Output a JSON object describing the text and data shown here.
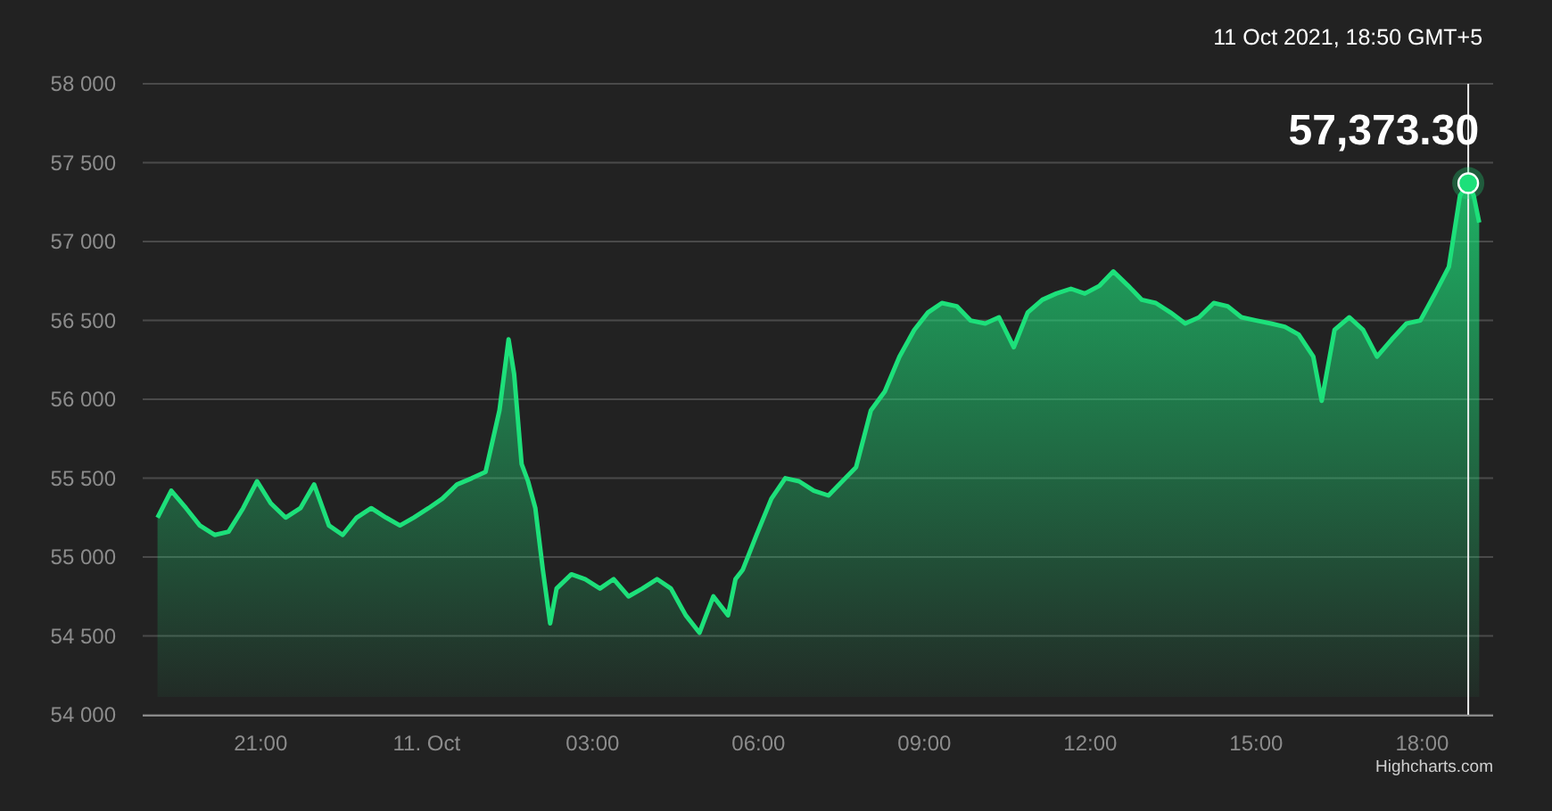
{
  "chart": {
    "chart_data": {
      "type": "area",
      "x": [
        "2021-10-10 19:08",
        "2021-10-10 19:23",
        "2021-10-10 19:39",
        "2021-10-10 19:54",
        "2021-10-10 20:10",
        "2021-10-10 20:25",
        "2021-10-10 20:41",
        "2021-10-10 20:56",
        "2021-10-10 21:11",
        "2021-10-10 21:27",
        "2021-10-10 21:43",
        "2021-10-10 21:58",
        "2021-10-10 22:14",
        "2021-10-10 22:29",
        "2021-10-10 22:44",
        "2021-10-10 23:00",
        "2021-10-10 23:16",
        "2021-10-10 23:31",
        "2021-10-10 23:46",
        "2021-10-11 00:02",
        "2021-10-11 00:17",
        "2021-10-11 00:33",
        "2021-10-11 00:49",
        "2021-10-11 01:04",
        "2021-10-11 01:19",
        "2021-10-11 01:29",
        "2021-10-11 01:35",
        "2021-10-11 01:43",
        "2021-10-11 01:50",
        "2021-10-11 01:58",
        "2021-10-11 02:06",
        "2021-10-11 02:14",
        "2021-10-11 02:21",
        "2021-10-11 02:37",
        "2021-10-11 02:52",
        "2021-10-11 03:08",
        "2021-10-11 03:23",
        "2021-10-11 03:39",
        "2021-10-11 03:54",
        "2021-10-11 04:10",
        "2021-10-11 04:25",
        "2021-10-11 04:41",
        "2021-10-11 04:56",
        "2021-10-11 05:11",
        "2021-10-11 05:27",
        "2021-10-11 05:35",
        "2021-10-11 05:43",
        "2021-10-11 05:58",
        "2021-10-11 06:14",
        "2021-10-11 06:29",
        "2021-10-11 06:44",
        "2021-10-11 07:00",
        "2021-10-11 07:16",
        "2021-10-11 07:31",
        "2021-10-11 07:46",
        "2021-10-11 08:02",
        "2021-10-11 08:17",
        "2021-10-11 08:33",
        "2021-10-11 08:49",
        "2021-10-11 09:04",
        "2021-10-11 09:19",
        "2021-10-11 09:35",
        "2021-10-11 09:50",
        "2021-10-11 10:06",
        "2021-10-11 10:21",
        "2021-10-11 10:37",
        "2021-10-11 10:52",
        "2021-10-11 11:08",
        "2021-10-11 11:23",
        "2021-10-11 11:39",
        "2021-10-11 11:54",
        "2021-10-11 12:10",
        "2021-10-11 12:25",
        "2021-10-11 12:41",
        "2021-10-11 12:56",
        "2021-10-11 13:11",
        "2021-10-11 13:27",
        "2021-10-11 13:43",
        "2021-10-11 13:58",
        "2021-10-11 14:14",
        "2021-10-11 14:29",
        "2021-10-11 14:44",
        "2021-10-11 15:00",
        "2021-10-11 15:16",
        "2021-10-11 15:31",
        "2021-10-11 15:46",
        "2021-10-11 16:02",
        "2021-10-11 16:11",
        "2021-10-11 16:25",
        "2021-10-11 16:41",
        "2021-10-11 16:56",
        "2021-10-11 17:11",
        "2021-10-11 17:27",
        "2021-10-11 17:43",
        "2021-10-11 17:58",
        "2021-10-11 18:14",
        "2021-10-11 18:29",
        "2021-10-11 18:41",
        "2021-10-11 18:50",
        "2021-10-11 18:56",
        "2021-10-11 19:02"
      ],
      "series": [
        {
          "color": "#1de07a",
          "values": [
            55250,
            55420,
            55310,
            55200,
            55140,
            55160,
            55310,
            55480,
            55340,
            55250,
            55310,
            55460,
            55200,
            55140,
            55250,
            55310,
            55250,
            55200,
            55250,
            55310,
            55370,
            55460,
            55500,
            55540,
            55930,
            56380,
            56160,
            55590,
            55480,
            55310,
            54920,
            54580,
            54800,
            54890,
            54860,
            54800,
            54860,
            54750,
            54800,
            54860,
            54800,
            54630,
            54520,
            54750,
            54630,
            54860,
            54920,
            55140,
            55370,
            55500,
            55480,
            55420,
            55390,
            55480,
            55570,
            55930,
            56050,
            56270,
            56440,
            56550,
            56610,
            56590,
            56500,
            56480,
            56520,
            56330,
            56550,
            56630,
            56670,
            56700,
            56670,
            56720,
            56810,
            56720,
            56630,
            56610,
            56550,
            56480,
            56520,
            56610,
            56590,
            56520,
            56500,
            56480,
            56460,
            56410,
            56270,
            55990,
            56440,
            56520,
            56440,
            56270,
            56380,
            56480,
            56500,
            56670,
            56840,
            57290,
            57370,
            57290,
            57120
          ]
        }
      ],
      "xlim": [
        "2021-10-10 18:52",
        "2021-10-11 19:17"
      ],
      "ylim": [
        54000,
        58000
      ],
      "xticks": [
        {
          "value": "2021-10-10 21:00",
          "label": "21:00"
        },
        {
          "value": "2021-10-11 00:00",
          "label": "11. Oct"
        },
        {
          "value": "2021-10-11 03:00",
          "label": "03:00"
        },
        {
          "value": "2021-10-11 06:00",
          "label": "06:00"
        },
        {
          "value": "2021-10-11 09:00",
          "label": "09:00"
        },
        {
          "value": "2021-10-11 12:00",
          "label": "12:00"
        },
        {
          "value": "2021-10-11 15:00",
          "label": "15:00"
        },
        {
          "value": "2021-10-11 18:00",
          "label": "18:00"
        }
      ],
      "yticks": [
        {
          "value": 54000,
          "label": "54 000"
        },
        {
          "value": 54500,
          "label": "54 500"
        },
        {
          "value": 55000,
          "label": "55 000"
        },
        {
          "value": 55500,
          "label": "55 500"
        },
        {
          "value": 56000,
          "label": "56 000"
        },
        {
          "value": 56500,
          "label": "56 500"
        },
        {
          "value": 57000,
          "label": "57 000"
        },
        {
          "value": 57500,
          "label": "57 500"
        },
        {
          "value": 58000,
          "label": "58 000"
        }
      ],
      "grid": true,
      "ref_lines": [
        {
          "axis": "x",
          "value": "2021-10-11 18:50"
        }
      ],
      "annotations": [
        {
          "x": "2021-10-11 18:50",
          "y": 57370,
          "text": "57,373.30"
        }
      ]
    },
    "tooltip_date": "11 Oct 2021, 18:50 GMT+5",
    "credits": "Highcharts.com"
  }
}
